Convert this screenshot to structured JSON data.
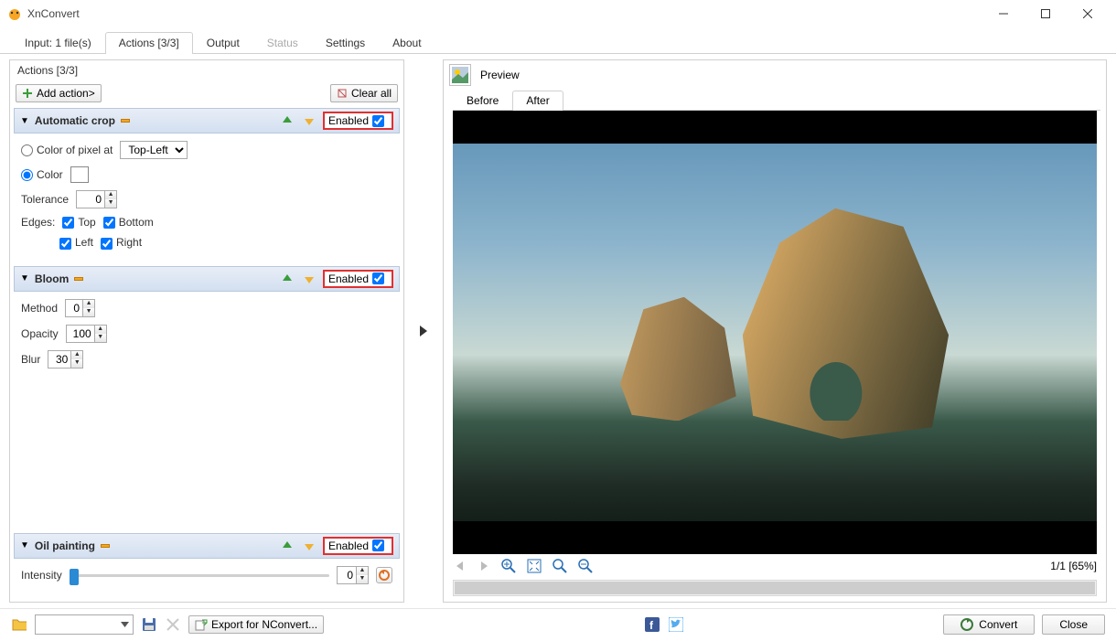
{
  "window": {
    "title": "XnConvert"
  },
  "tabs": {
    "input": "Input: 1 file(s)",
    "actions": "Actions [3/3]",
    "output": "Output",
    "status": "Status",
    "settings": "Settings",
    "about": "About"
  },
  "actionsPanel": {
    "title": "Actions [3/3]",
    "addAction": "Add action>",
    "clearAll": "Clear all"
  },
  "enabledLabel": "Enabled",
  "action1": {
    "name": "Automatic crop",
    "pixelAtLabel": "Color of pixel at",
    "pixelAtValue": "Top-Left",
    "colorLabel": "Color",
    "toleranceLabel": "Tolerance",
    "toleranceValue": "0",
    "edgesLabel": "Edges:",
    "top": "Top",
    "bottom": "Bottom",
    "left": "Left",
    "right": "Right"
  },
  "action2": {
    "name": "Bloom",
    "methodLabel": "Method",
    "methodValue": "0",
    "opacityLabel": "Opacity",
    "opacityValue": "100",
    "blurLabel": "Blur",
    "blurValue": "30"
  },
  "action3": {
    "name": "Oil painting",
    "intensityLabel": "Intensity",
    "intensityValue": "0"
  },
  "preview": {
    "label": "Preview",
    "before": "Before",
    "after": "After",
    "counter": "1/1 [65%]"
  },
  "bottom": {
    "export": "Export for NConvert...",
    "convert": "Convert",
    "close": "Close"
  }
}
